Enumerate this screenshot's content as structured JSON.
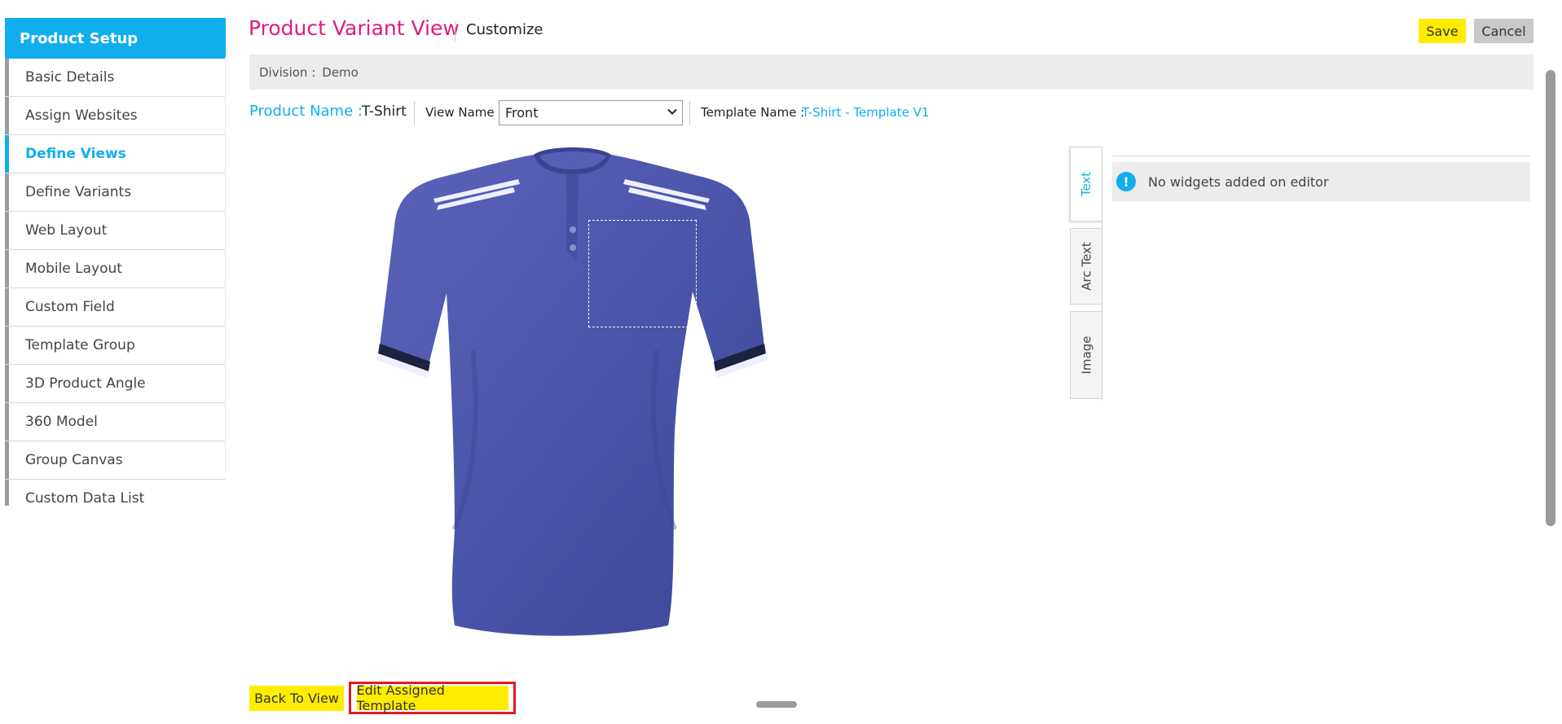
{
  "sidebar": {
    "header": "Product Setup",
    "items": [
      {
        "label": "Basic Details",
        "active": false
      },
      {
        "label": "Assign Websites",
        "active": false
      },
      {
        "label": "Define Views",
        "active": true
      },
      {
        "label": "Define Variants",
        "active": false
      },
      {
        "label": "Web Layout",
        "active": false
      },
      {
        "label": "Mobile Layout",
        "active": false
      },
      {
        "label": "Custom Field",
        "active": false
      },
      {
        "label": "Template Group",
        "active": false
      },
      {
        "label": "3D Product Angle",
        "active": false
      },
      {
        "label": "360 Model",
        "active": false
      },
      {
        "label": "Group Canvas",
        "active": false
      },
      {
        "label": "Custom Data List",
        "active": false
      }
    ]
  },
  "header": {
    "title": "Product Variant View",
    "subtitle": "Customize",
    "save_label": "Save",
    "cancel_label": "Cancel"
  },
  "division": {
    "label": "Division :",
    "value": "Demo"
  },
  "product": {
    "name_label": "Product Name :",
    "name_value": "T-Shirt",
    "view_label": "View Name",
    "view_value": "Front",
    "template_label": "Template Name :",
    "template_value": "T-Shirt - Template V1"
  },
  "editor": {
    "tabs": [
      "Text",
      "Arc Text",
      "Image"
    ],
    "active_tab": "Text",
    "notice": "No widgets added on editor"
  },
  "footer": {
    "back_label": "Back To View",
    "edit_template_label": "Edit Assigned Template"
  },
  "colors": {
    "accent": "#11aeed",
    "title": "#e01a83",
    "button": "#ffec00",
    "shirt": "#4a54a8"
  }
}
